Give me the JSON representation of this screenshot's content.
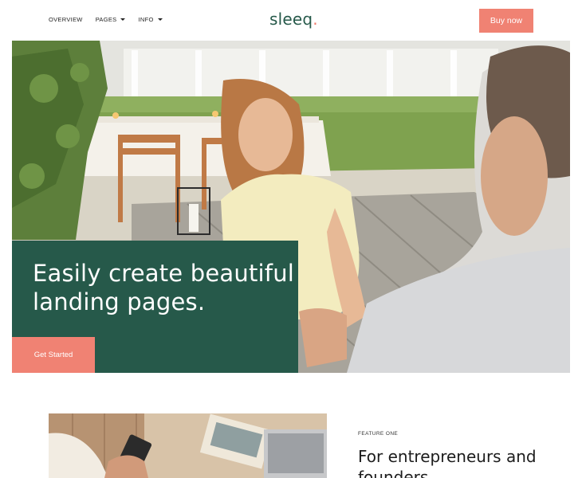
{
  "header": {
    "nav": [
      {
        "label": "OVERVIEW",
        "has_dropdown": false
      },
      {
        "label": "PAGES",
        "has_dropdown": true
      },
      {
        "label": "INFO",
        "has_dropdown": true
      }
    ],
    "logo_text": "sleeq",
    "logo_dot": ".",
    "buy_label": "Buy now"
  },
  "hero": {
    "title": "Easily create beautiful landing pages.",
    "cta_label": "Get Started"
  },
  "feature": {
    "eyebrow": "FEATURE ONE",
    "title": "For entrepreneurs and founders"
  },
  "colors": {
    "brand_green": "#26594a",
    "accent_coral": "#f08273"
  }
}
